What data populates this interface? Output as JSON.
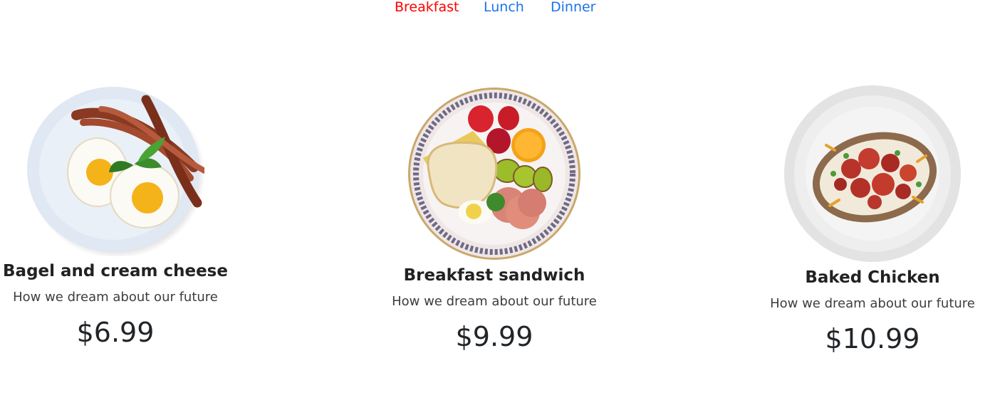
{
  "nav": {
    "tabs": [
      {
        "label": "Breakfast",
        "active": true
      },
      {
        "label": "Lunch",
        "active": false
      },
      {
        "label": "Dinner",
        "active": false
      }
    ]
  },
  "colors": {
    "active_tab": "#ff0000",
    "inactive_tab": "#1a73e8",
    "text": "#212529"
  },
  "menu": {
    "items": [
      {
        "title": "Bagel and cream cheese",
        "description": "How we dream about our future",
        "price": "$6.99",
        "image": "bacon-and-eggs-plate"
      },
      {
        "title": "Breakfast sandwich",
        "description": "How we dream about our future",
        "price": "$9.99",
        "image": "bread-fruit-plate"
      },
      {
        "title": "Baked Chicken",
        "description": "How we dream about our future",
        "price": "$10.99",
        "image": "loaded-baked-potato-plate"
      }
    ]
  }
}
